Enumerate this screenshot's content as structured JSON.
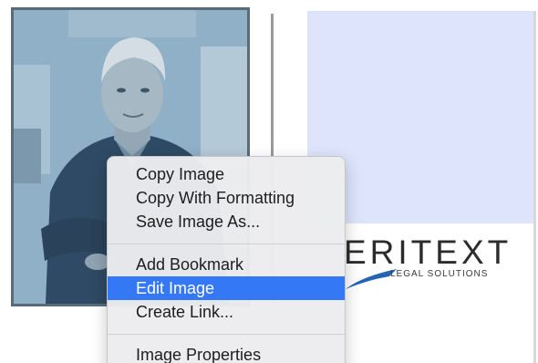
{
  "menu": {
    "items": [
      {
        "label": "Copy Image"
      },
      {
        "label": "Copy With Formatting"
      },
      {
        "label": "Save Image As..."
      },
      {
        "label": "Add Bookmark"
      },
      {
        "label": "Edit Image",
        "highlighted": true
      },
      {
        "label": "Create Link..."
      },
      {
        "label": "Image Properties"
      }
    ]
  },
  "logo": {
    "word": "ERITEXT",
    "tagline": "LEGAL SOLUTIONS"
  },
  "colors": {
    "highlight": "#3478f6",
    "selection_overlay": "#9db7cb",
    "placeholder": "#dde4fc"
  }
}
